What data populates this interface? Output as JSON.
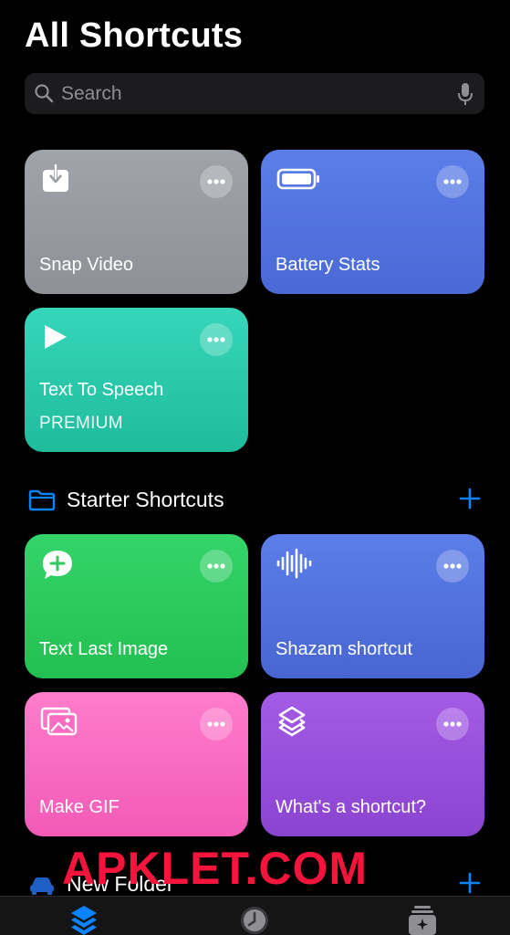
{
  "header": {
    "title": "All Shortcuts"
  },
  "search": {
    "placeholder": "Search",
    "icon": "search-icon",
    "mic_icon": "microphone-icon"
  },
  "shortcuts": [
    {
      "name": "Snap Video",
      "icon": "download-tray-icon",
      "color": "#9a9ea4"
    },
    {
      "name": "Battery Stats",
      "icon": "battery-icon",
      "color": "#5274e0"
    },
    {
      "name": "Text To Speech",
      "badge": "PREMIUM",
      "icon": "play-icon",
      "color": "#2bcaae"
    }
  ],
  "sections": [
    {
      "title": "Starter Shortcuts",
      "icon": "folder-icon",
      "items": [
        {
          "name": "Text Last Image",
          "icon": "message-plus-icon",
          "color": "#2dcb5f"
        },
        {
          "name": "Shazam shortcut",
          "icon": "waveform-icon",
          "color": "#5274e0"
        },
        {
          "name": "Make GIF",
          "icon": "photos-icon",
          "color": "#f86cc2"
        },
        {
          "name": "What's a shortcut?",
          "icon": "shortcuts-layers-icon",
          "color": "#9850dc"
        }
      ]
    },
    {
      "title": "New Folder",
      "icon": "car-icon"
    }
  ],
  "watermark": "APKLET.COM",
  "tabbar": [
    {
      "name": "Shortcuts",
      "icon": "layers-icon",
      "active": true
    },
    {
      "name": "Automation",
      "icon": "clock-icon"
    },
    {
      "name": "Gallery",
      "icon": "gallery-icon"
    }
  ],
  "colors": {
    "accent": "#0a84ff",
    "background": "#000000",
    "search_bg": "#1c1c1e"
  }
}
